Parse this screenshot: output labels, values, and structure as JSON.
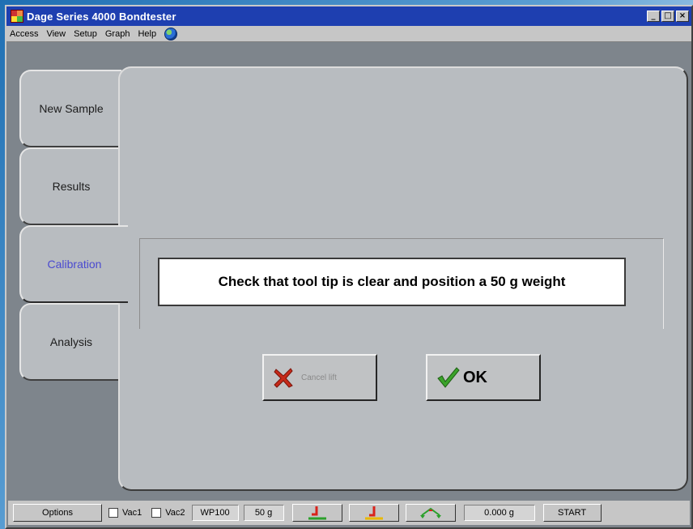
{
  "window": {
    "title": "Dage Series 4000 Bondtester",
    "minimize": "_",
    "maximize": "□",
    "close": "×"
  },
  "menu": [
    "Access",
    "View",
    "Setup",
    "Graph",
    "Help"
  ],
  "tabs": [
    {
      "label": "New Sample"
    },
    {
      "label": "Results"
    },
    {
      "label": "Calibration",
      "active": true
    },
    {
      "label": "Analysis"
    }
  ],
  "dialog": {
    "message": "Check that tool tip is clear and position a 50 g weight",
    "cancel_label": "Cancel lift",
    "ok_label": "OK"
  },
  "statusbar": {
    "options": "Options",
    "vac1": "Vac1",
    "vac2": "Vac2",
    "workholder": "WP100",
    "load": "50 g",
    "reading": "0.000 g",
    "start": "START"
  },
  "icons": {
    "app": "app-icon",
    "help": "globe-icon",
    "cancel": "x-icon",
    "ok": "check-icon",
    "tool1": "tool-down-icon",
    "tool2": "tool-up-icon",
    "tool3": "scale-icon"
  },
  "colors": {
    "titlebar": "#1e3fb0",
    "active_tab_text": "#4a4ad0",
    "cancel_x": "#c62a1a",
    "ok_check": "#3aa32a"
  }
}
